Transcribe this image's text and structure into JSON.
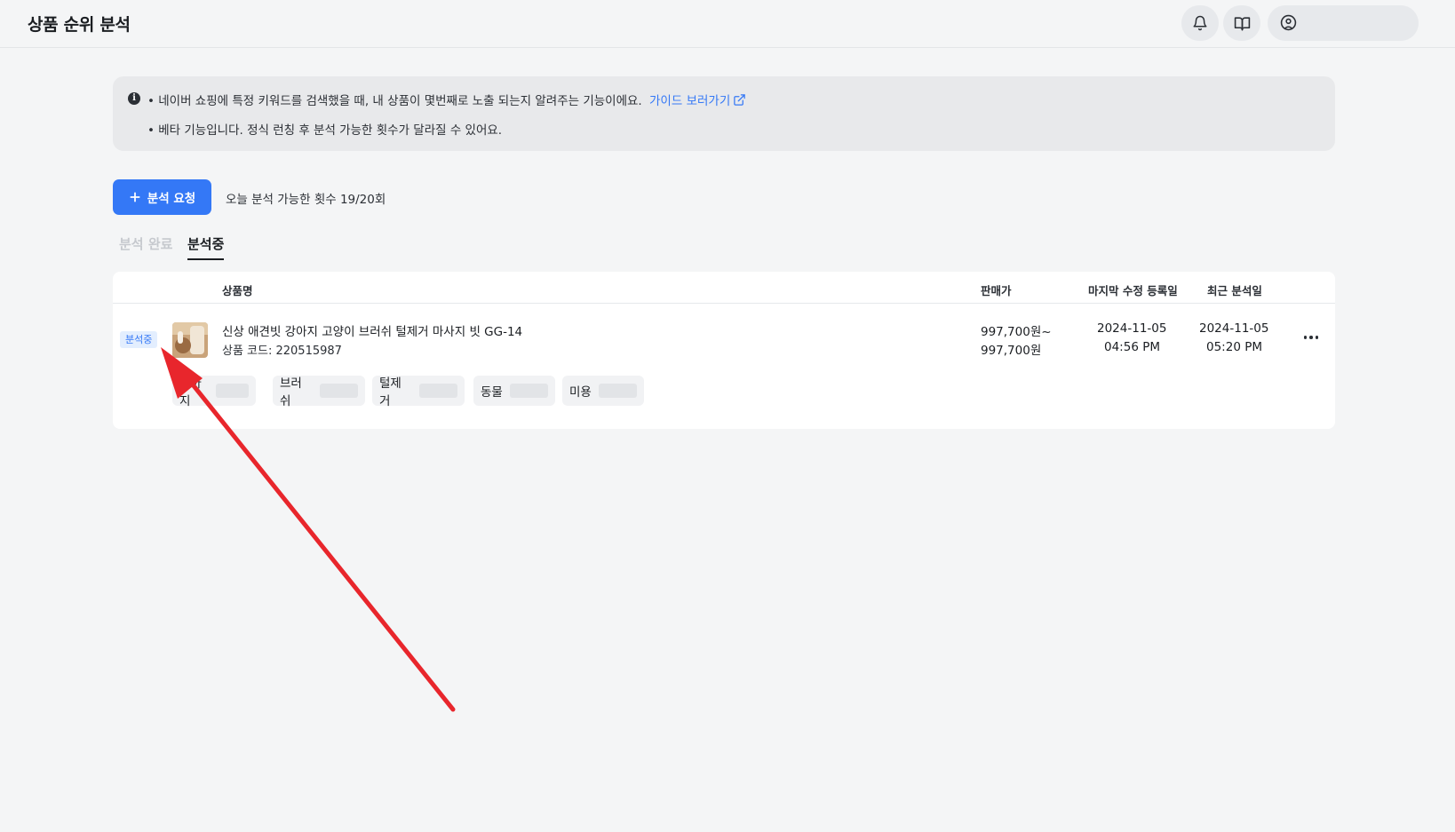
{
  "header": {
    "title": "상품 순위 분석",
    "bell_icon": "bell-icon",
    "book_icon": "book-open-icon",
    "user_icon": "user-circle-icon"
  },
  "info": {
    "line1": "• 네이버 쇼핑에 특정 키워드를 검색했을 때, 내 상품이 몇번째로 노출 되는지 알려주는 기능이에요.",
    "guide_link": "가이드 보러가기",
    "line2": "• 베타 기능입니다. 정식 런칭 후 분석 가능한 횟수가 달라질 수 있어요."
  },
  "actions": {
    "request_label": "분석 요청",
    "quota_text": "오늘 분석 가능한 횟수 19/20회"
  },
  "tabs": [
    {
      "label": "분석 완료",
      "active": false
    },
    {
      "label": "분석중",
      "active": true
    }
  ],
  "table": {
    "columns": {
      "product": "상품명",
      "price": "판매가",
      "last_modified": "마지막 수정 등록일",
      "recent_analysis": "최근 분석일"
    },
    "rows": [
      {
        "status": "분석중",
        "name": "신상 애견빗 강아지 고양이 브러쉬 털제거 마사지 빗 GG-14",
        "code": "상품 코드: 220515987",
        "price_min": "997,700원~",
        "price_max": "997,700원",
        "modified_date": "2024-11-05",
        "modified_time": "04:56 PM",
        "analysis_date": "2024-11-05",
        "analysis_time": "05:20 PM",
        "keywords": [
          "강아지",
          "브러쉬",
          "털제거",
          "동물",
          "미용"
        ]
      }
    ]
  },
  "colors": {
    "accent": "#3478f6",
    "badge_bg": "#e3eefe",
    "annotation_arrow": "#e8262c"
  }
}
